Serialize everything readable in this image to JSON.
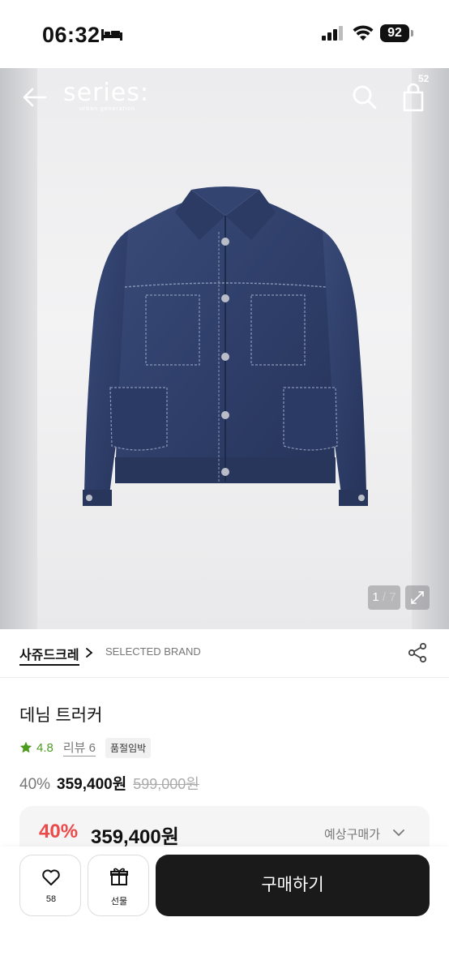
{
  "status_bar": {
    "time": "06:32",
    "battery": "92"
  },
  "header": {
    "logo": "series:",
    "logo_sub": "urban generation",
    "bag_count": "52"
  },
  "gallery": {
    "current": "1",
    "total": "7"
  },
  "brand": {
    "name": "사쥬드크레",
    "tag": "SELECTED BRAND"
  },
  "product": {
    "title": "데님 트러커",
    "rating": "4.8",
    "reviews": "리뷰 6",
    "status_badge": "품절임박",
    "discount": "40%",
    "price": "359,400원",
    "original_price": "599,000원"
  },
  "expected": {
    "discount": "40%",
    "price": "359,400원",
    "label": "예상구매가"
  },
  "actions": {
    "like_count": "58",
    "gift_label": "선물",
    "buy_label": "구매하기"
  },
  "colors": {
    "accent_red": "#ec4a4a",
    "rating_green": "#4c9a1e",
    "buy_bg": "#1a1a1a"
  }
}
